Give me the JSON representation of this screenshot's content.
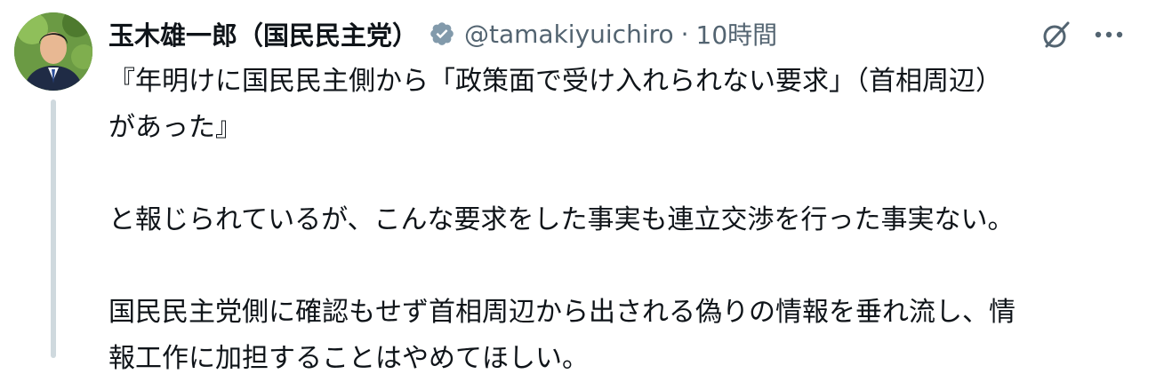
{
  "author": {
    "name": "玉木雄一郎（国民民主党）",
    "handle": "@tamakiyuichiro",
    "separator": "·",
    "time": "10時間"
  },
  "colors": {
    "text": "#0f1419",
    "secondary": "#536471",
    "thread_line": "#cfd9de",
    "verified_badge": "#829aab"
  },
  "icons": {
    "verified": "verified-badge-icon",
    "grok": "grok-icon",
    "more": "more-icon"
  },
  "tweet": {
    "para1_line1": "『年明けに国民民主側から「政策面で受け入れられない要求」（首相周辺）",
    "para1_line2": "があった』",
    "para2": "と報じられているが、こんな要求をした事実も連立交渉を行った事実ない。",
    "para3_line1": "国民民主党側に確認もせず首相周辺から出される偽りの情報を垂れ流し、情",
    "para3_line2": "報工作に加担することはやめてほしい。"
  }
}
